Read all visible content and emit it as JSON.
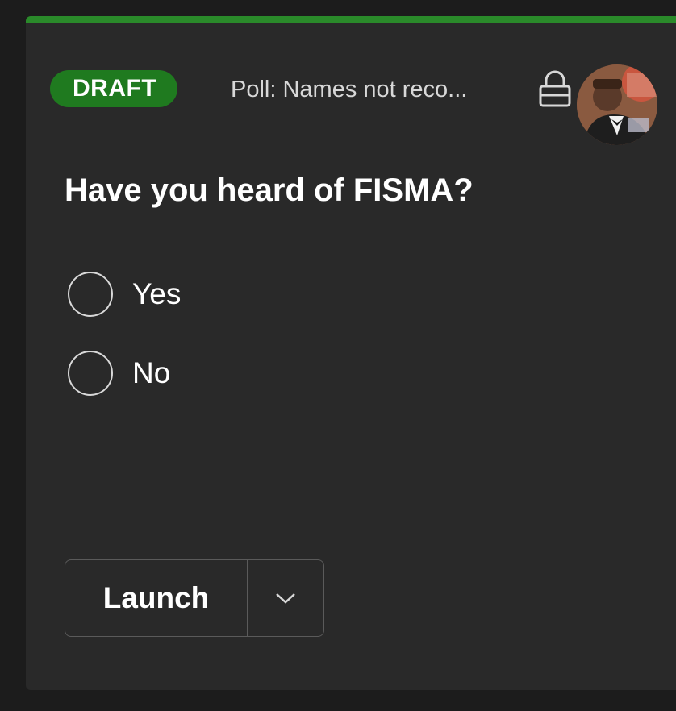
{
  "card": {
    "status_badge": "DRAFT",
    "poll_title": "Poll: Names not reco...",
    "lock_icon": "lock-icon",
    "avatar_icon": "user-avatar",
    "question": "Have you heard of FISMA?",
    "options": [
      {
        "label": "Yes",
        "selected": false
      },
      {
        "label": "No",
        "selected": false
      }
    ],
    "launch_label": "Launch",
    "dropdown_icon": "chevron-down-icon"
  },
  "colors": {
    "accent": "#2a8a2a",
    "badge": "#1f7a1f",
    "card_bg": "#292929",
    "page_bg": "#1c1c1c",
    "text": "#ffffff"
  }
}
